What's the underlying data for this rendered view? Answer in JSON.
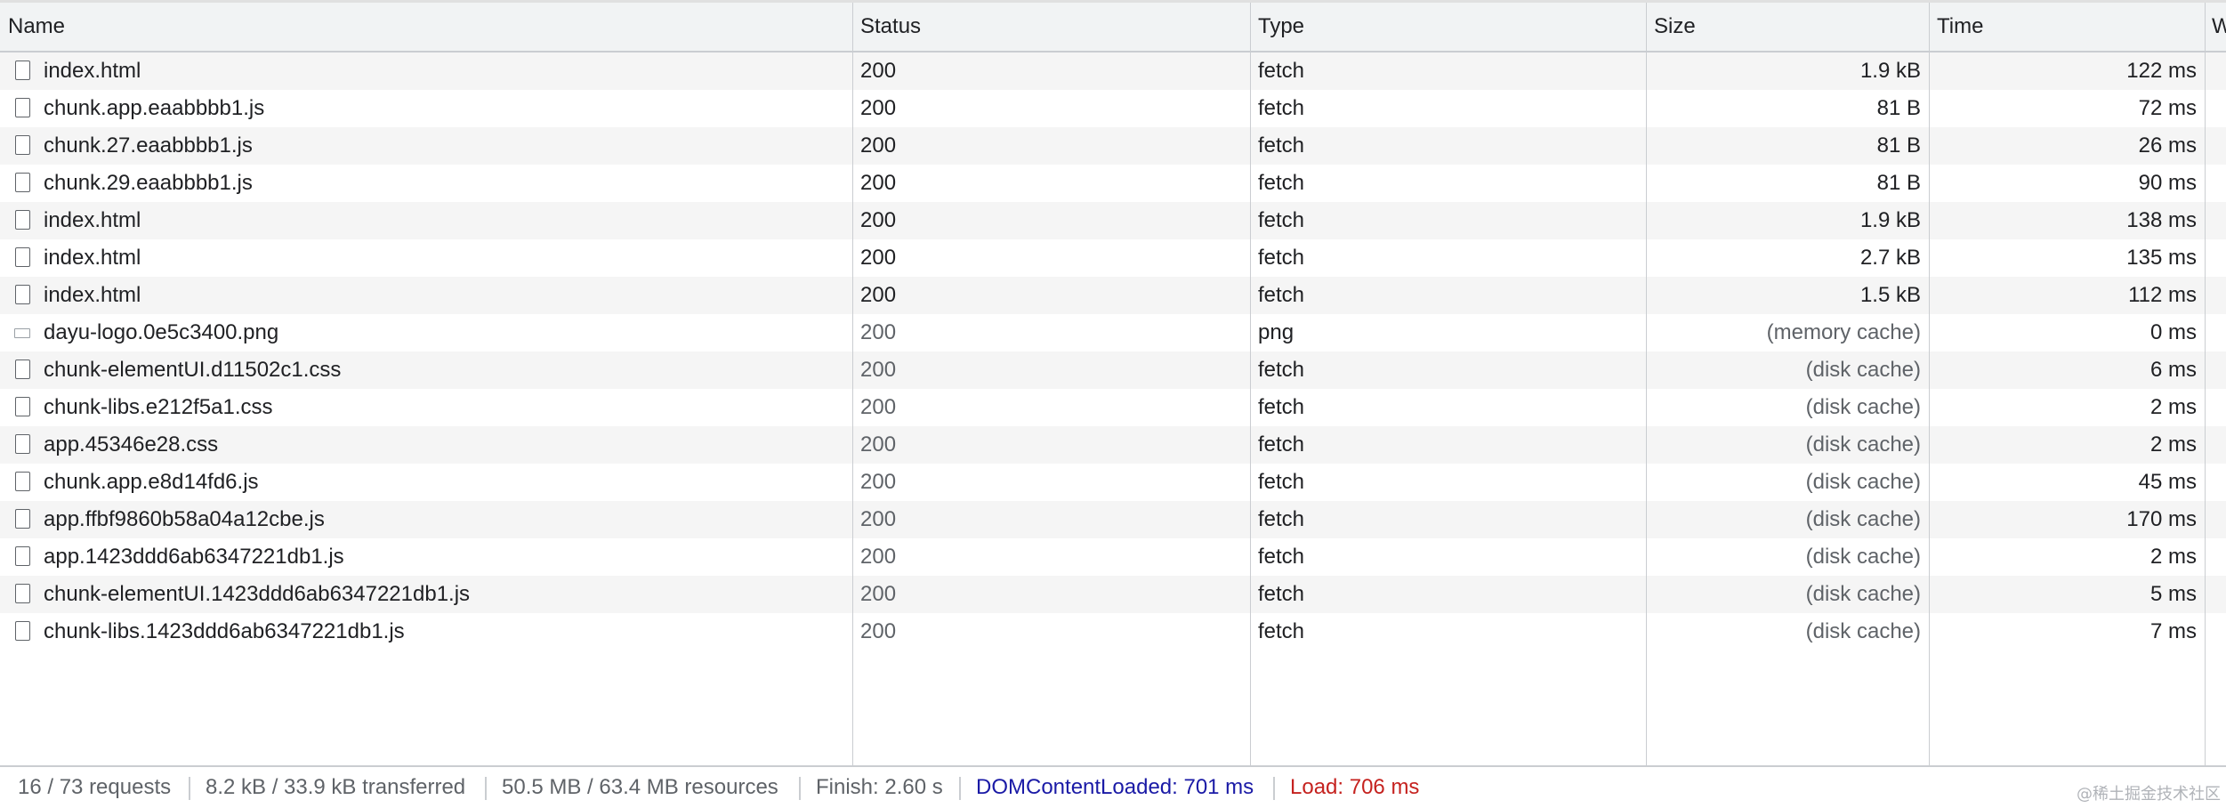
{
  "columns": {
    "name": "Name",
    "status": "Status",
    "type": "Type",
    "size": "Size",
    "time": "Time",
    "waterfall": "W"
  },
  "requests": [
    {
      "name": "index.html",
      "status": "200",
      "type": "fetch",
      "size": "1.9 kB",
      "time": "122 ms",
      "icon": "document-icon"
    },
    {
      "name": "chunk.app.eaabbbb1.js",
      "status": "200",
      "type": "fetch",
      "size": "81 B",
      "time": "72 ms",
      "icon": "document-icon"
    },
    {
      "name": "chunk.27.eaabbbb1.js",
      "status": "200",
      "type": "fetch",
      "size": "81 B",
      "time": "26 ms",
      "icon": "document-icon"
    },
    {
      "name": "chunk.29.eaabbbb1.js",
      "status": "200",
      "type": "fetch",
      "size": "81 B",
      "time": "90 ms",
      "icon": "document-icon"
    },
    {
      "name": "index.html",
      "status": "200",
      "type": "fetch",
      "size": "1.9 kB",
      "time": "138 ms",
      "icon": "document-icon"
    },
    {
      "name": "index.html",
      "status": "200",
      "type": "fetch",
      "size": "2.7 kB",
      "time": "135 ms",
      "icon": "document-icon"
    },
    {
      "name": "index.html",
      "status": "200",
      "type": "fetch",
      "size": "1.5 kB",
      "time": "112 ms",
      "icon": "document-icon"
    },
    {
      "name": "dayu-logo.0e5c3400.png",
      "status": "200",
      "type": "png",
      "size": "(memory cache)",
      "time": "0 ms",
      "icon": "image-icon"
    },
    {
      "name": "chunk-elementUI.d11502c1.css",
      "status": "200",
      "type": "fetch",
      "size": "(disk cache)",
      "time": "6 ms",
      "icon": "document-icon"
    },
    {
      "name": "chunk-libs.e212f5a1.css",
      "status": "200",
      "type": "fetch",
      "size": "(disk cache)",
      "time": "2 ms",
      "icon": "document-icon"
    },
    {
      "name": "app.45346e28.css",
      "status": "200",
      "type": "fetch",
      "size": "(disk cache)",
      "time": "2 ms",
      "icon": "document-icon"
    },
    {
      "name": "chunk.app.e8d14fd6.js",
      "status": "200",
      "type": "fetch",
      "size": "(disk cache)",
      "time": "45 ms",
      "icon": "document-icon"
    },
    {
      "name": "app.ffbf9860b58a04a12cbe.js",
      "status": "200",
      "type": "fetch",
      "size": "(disk cache)",
      "time": "170 ms",
      "icon": "document-icon"
    },
    {
      "name": "app.1423ddd6ab6347221db1.js",
      "status": "200",
      "type": "fetch",
      "size": "(disk cache)",
      "time": "2 ms",
      "icon": "document-icon"
    },
    {
      "name": "chunk-elementUI.1423ddd6ab6347221db1.js",
      "status": "200",
      "type": "fetch",
      "size": "(disk cache)",
      "time": "5 ms",
      "icon": "document-icon"
    },
    {
      "name": "chunk-libs.1423ddd6ab6347221db1.js",
      "status": "200",
      "type": "fetch",
      "size": "(disk cache)",
      "time": "7 ms",
      "icon": "document-icon"
    }
  ],
  "summary": {
    "requests": "16 / 73 requests",
    "transferred": "8.2 kB / 33.9 kB transferred",
    "resources": "50.5 MB / 63.4 MB resources",
    "finish": "Finish: 2.60 s",
    "dom_content_loaded": "DOMContentLoaded: 701 ms",
    "load": "Load: 706 ms"
  },
  "watermark": "@稀土掘金技术社区",
  "colors": {
    "dom_content_loaded": "#1a1aa6",
    "load": "#c5221f",
    "header_bg": "#f1f3f4",
    "row_alt_bg": "#f5f5f5"
  }
}
